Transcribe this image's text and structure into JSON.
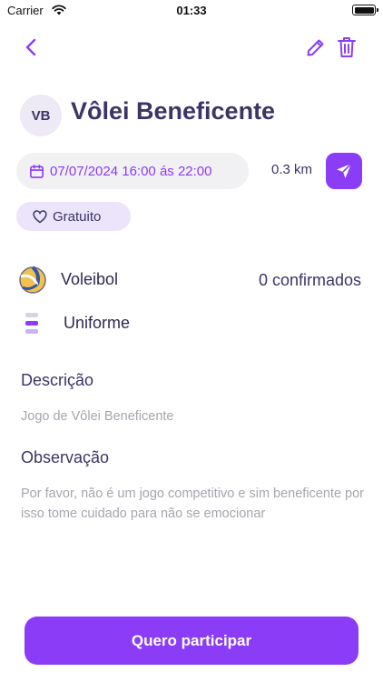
{
  "status_bar": {
    "carrier": "Carrier",
    "time": "01:33"
  },
  "event": {
    "avatar_initials": "VB",
    "title": "Vôlei Beneficente",
    "datetime": "07/07/2024 16:00 ás 22:00",
    "distance": "0.3 km",
    "price": "Gratuito",
    "sport": "Voleibol",
    "confirmed": "0 confirmados",
    "dress": "Uniforme"
  },
  "description": {
    "title": "Descrição",
    "text": "Jogo de Vôlei Beneficente"
  },
  "observation": {
    "title": "Observação",
    "text": "Por favor, não é um jogo competitivo e sim beneficente por isso tome cuidado para não se emocionar"
  },
  "cta": {
    "label": "Quero participar"
  },
  "icons": {
    "back": "chevron-left-icon",
    "edit": "pencil-icon",
    "delete": "trash-icon",
    "calendar": "calendar-icon",
    "send": "send-icon",
    "price": "heart-icon",
    "sport": "volleyball-icon",
    "dress": "uniform-icon"
  },
  "colors": {
    "accent": "#8b3cf6",
    "text": "#3b3566",
    "muted": "#a7a5ae",
    "chip_bg": "#f1f0f3",
    "price_chip_bg": "#ebe4fb"
  }
}
